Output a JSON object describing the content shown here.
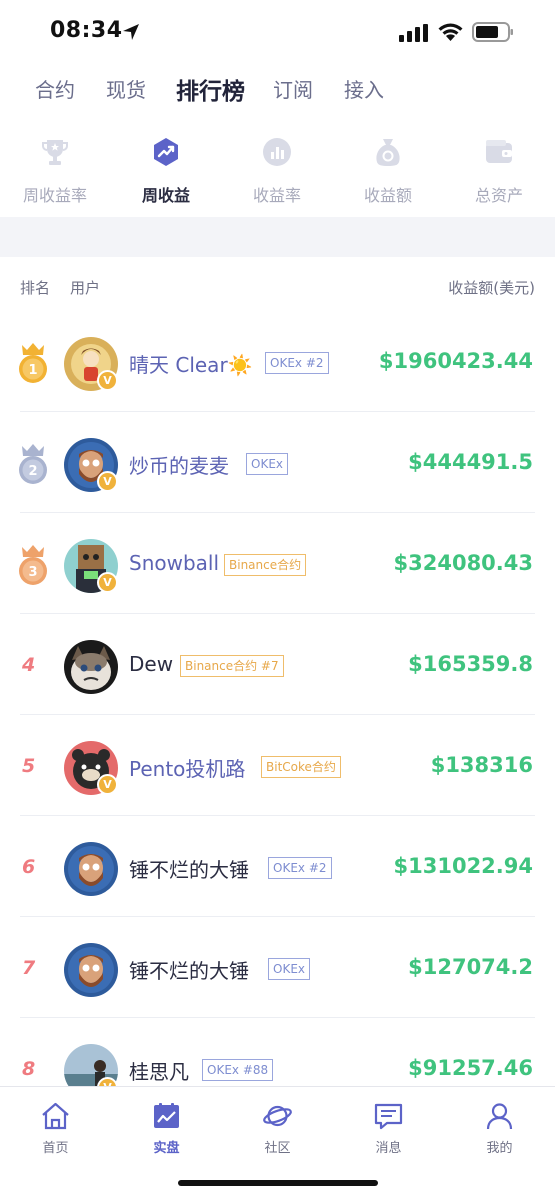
{
  "status_bar": {
    "time": "08:34"
  },
  "top_tabs": [
    {
      "label": "合约"
    },
    {
      "label": "现货"
    },
    {
      "label": "排行榜"
    },
    {
      "label": "订阅"
    },
    {
      "label": "接入"
    }
  ],
  "active_top_tab": "排行榜",
  "sub_tabs": [
    {
      "label": "周收益率",
      "icon": "trophy-icon"
    },
    {
      "label": "周收益",
      "icon": "trend-chart-icon"
    },
    {
      "label": "收益率",
      "icon": "bar-chart-icon"
    },
    {
      "label": "收益额",
      "icon": "money-bag-icon"
    },
    {
      "label": "总资产",
      "icon": "wallet-icon"
    }
  ],
  "active_sub_tab": "周收益",
  "table_header": {
    "rank": "排名",
    "user": "用户",
    "amount": "收益额(美元)"
  },
  "rows": [
    {
      "rank": "1",
      "medal": "gold",
      "name": "晴天 Clear☀️",
      "tag": "OKEx #2",
      "tag_style": "blue",
      "amount": "$1960423.44",
      "verified": "V"
    },
    {
      "rank": "2",
      "medal": "silver",
      "name": "炒币的麦麦",
      "tag": "OKEx",
      "tag_style": "blue",
      "amount": "$444491.5",
      "verified": "V"
    },
    {
      "rank": "3",
      "medal": "bronze",
      "name": "Snowball",
      "tag": "Binance合约",
      "tag_style": "orange",
      "amount": "$324080.43",
      "verified": "V"
    },
    {
      "rank": "4",
      "medal": "",
      "name": "Dew",
      "tag": "Binance合约 #7",
      "tag_style": "orange",
      "amount": "$165359.8",
      "verified": ""
    },
    {
      "rank": "5",
      "medal": "",
      "name": "Pento投机路",
      "tag": "BitCoke合约",
      "tag_style": "orange",
      "amount": "$138316",
      "verified": "V"
    },
    {
      "rank": "6",
      "medal": "",
      "name": "锤不烂的大锤",
      "tag": "OKEx #2",
      "tag_style": "blue",
      "amount": "$131022.94",
      "verified": ""
    },
    {
      "rank": "7",
      "medal": "",
      "name": "锤不烂的大锤",
      "tag": "OKEx",
      "tag_style": "blue",
      "amount": "$127074.2",
      "verified": ""
    },
    {
      "rank": "8",
      "medal": "",
      "name": "桂思凡",
      "tag": "OKEx #88",
      "tag_style": "blue",
      "amount": "$91257.46",
      "verified": "V"
    }
  ],
  "bottom_nav": [
    {
      "label": "首页",
      "icon": "home-icon"
    },
    {
      "label": "实盘",
      "icon": "live-chart-icon"
    },
    {
      "label": "社区",
      "icon": "planet-icon"
    },
    {
      "label": "消息",
      "icon": "message-icon"
    },
    {
      "label": "我的",
      "icon": "profile-icon"
    }
  ],
  "active_bottom_nav": "实盘",
  "colors": {
    "accent": "#5c63c8",
    "profit_green": "#3fc37e",
    "rank_red": "#ef7b80",
    "gold": "#f2b233",
    "silver": "#a9b3cf",
    "bronze": "#eea26a",
    "verified_badge": "#f0b23b"
  }
}
